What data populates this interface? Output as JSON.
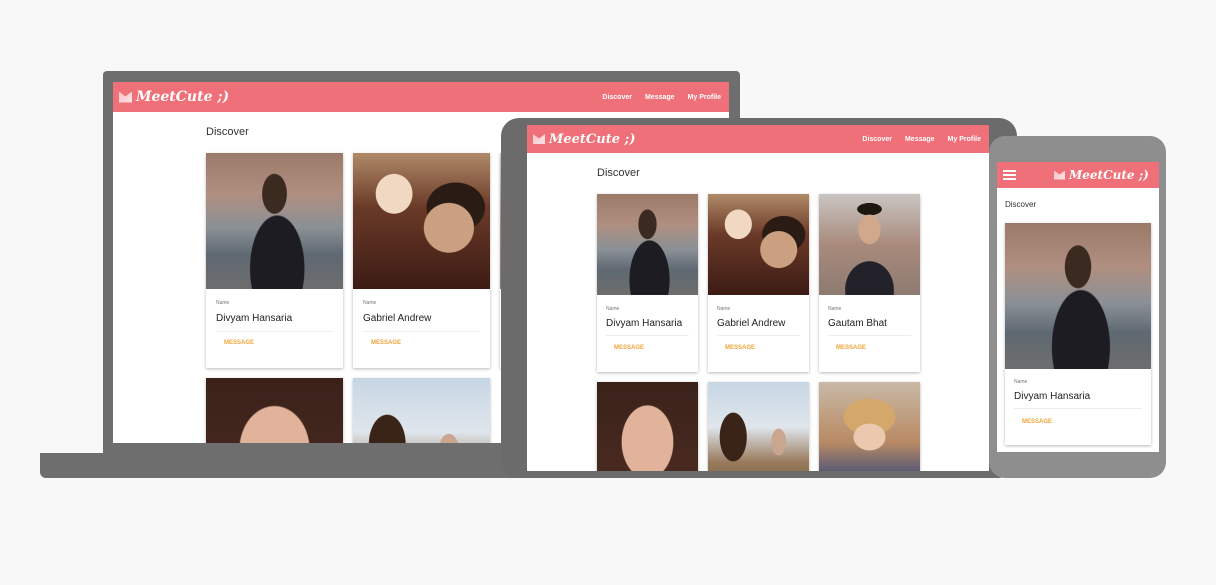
{
  "app": {
    "brand": "MeetCute ;)"
  },
  "nav": {
    "discover": "Discover",
    "message": "Message",
    "profile": "My Profile"
  },
  "page": {
    "title": "Discover"
  },
  "card": {
    "name_label": "Name",
    "message_label": "MESSAGE"
  },
  "profiles": [
    {
      "name": "Divyam Hansaria"
    },
    {
      "name": "Gabriel Andrew"
    },
    {
      "name": "Gautam Bhat"
    }
  ],
  "colors": {
    "navbar": "#ef7078",
    "accent": "#f0a53a",
    "background": "#f8f8f8"
  },
  "icons": {
    "menu": "hamburger-icon",
    "logo": "meetcute-logo-icon"
  }
}
